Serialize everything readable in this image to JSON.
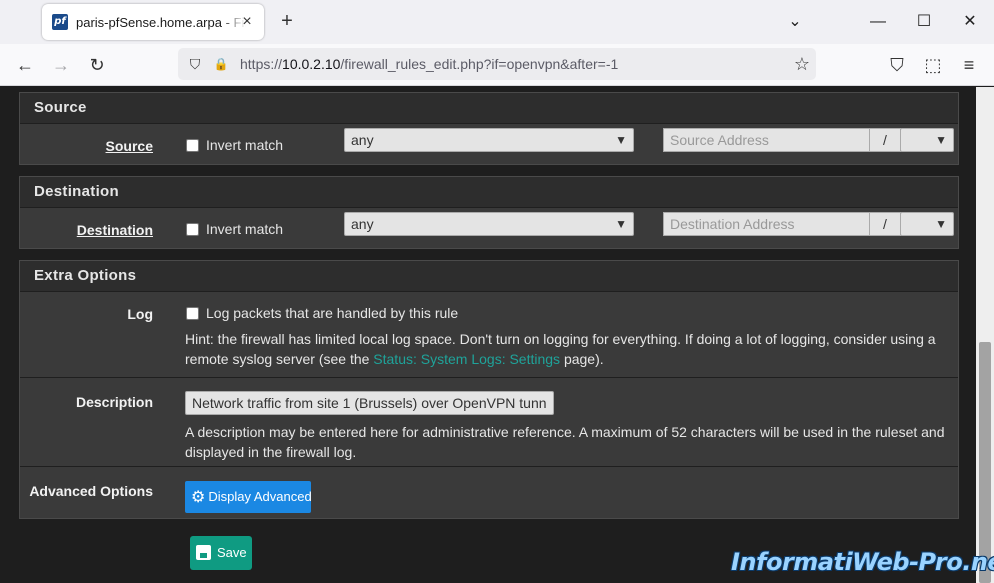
{
  "browser": {
    "tab_title": "paris-pfSense.home.arpa - Firewall",
    "favicon_text": "pf",
    "url_prefix": "https://",
    "url_host": "10.0.2.10",
    "url_path": "/firewall_rules_edit.php?if=openvpn&after=-1",
    "icons": {
      "close": "×",
      "new_tab": "+",
      "list_all": "⌄",
      "minimize": "—",
      "maximize": "☐",
      "win_close": "✕",
      "back": "←",
      "forward": "→",
      "reload": "↻",
      "shield": "⛉",
      "lock": "🔒",
      "star": "☆",
      "pocket": "⛉",
      "extensions": "⬚",
      "menu": "≡"
    }
  },
  "source": {
    "heading": "Source",
    "label": "Source",
    "invert_label": "Invert match",
    "type_value": "any",
    "address_placeholder": "Source Address",
    "slash": "/"
  },
  "destination": {
    "heading": "Destination",
    "label": "Destination",
    "invert_label": "Invert match",
    "type_value": "any",
    "address_placeholder": "Destination Address",
    "slash": "/"
  },
  "extra": {
    "heading": "Extra Options",
    "log_label": "Log",
    "log_checkbox_label": "Log packets that are handled by this rule",
    "log_hint_before": "Hint: the firewall has limited local log space. Don't turn on logging for everything. If doing a lot of logging, consider using a remote syslog server (see the ",
    "log_hint_link": "Status: System Logs: Settings",
    "log_hint_after": " page).",
    "description_label": "Description",
    "description_value": "Network traffic from site 1 (Brussels) over OpenVPN tunn",
    "description_hint": "A description may be entered here for administrative reference. A maximum of 52 characters will be used in the ruleset and displayed in the firewall log.",
    "advanced_label": "Advanced Options",
    "advanced_button": "Display Advanced"
  },
  "save_button": "Save",
  "watermark": "InformatiWeb-Pro.net",
  "colors": {
    "accent_link": "#1fa39a",
    "advanced_button": "#1b88e3",
    "save_button": "#0f9b82"
  }
}
